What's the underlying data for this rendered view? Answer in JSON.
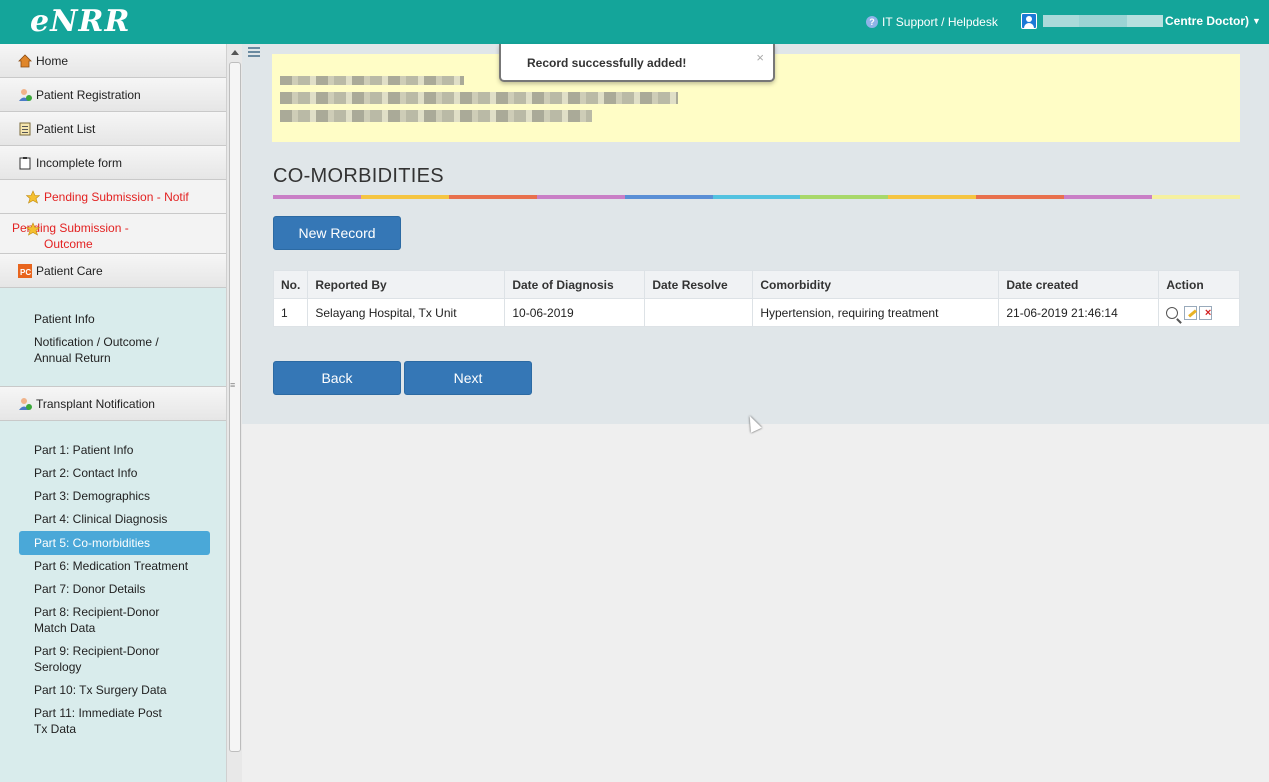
{
  "app": {
    "logo": "eNRR"
  },
  "header": {
    "support_label": "IT Support / Helpdesk",
    "user_label": "Centre Doctor)"
  },
  "sidebar": {
    "items": [
      {
        "label": "Home",
        "icon": "home-icon"
      },
      {
        "label": "Patient Registration",
        "icon": "user-add-icon"
      },
      {
        "label": "Patient List",
        "icon": "list-icon"
      },
      {
        "label": "Incomplete form",
        "icon": "clipboard-icon"
      },
      {
        "label": "Pending Submission - Notif",
        "icon": "star-icon"
      },
      {
        "label": "Pending Submission - Outcome",
        "icon": "star-icon"
      },
      {
        "label": "Patient Care",
        "icon": "pc-icon"
      }
    ],
    "patient_care_sub": [
      "Patient Info",
      "Notification / Outcome / Annual Return"
    ],
    "transplant_label": "Transplant Notification",
    "transplant_sub": [
      "Part 1: Patient Info",
      "Part 2: Contact Info",
      "Part 3: Demographics",
      "Part 4: Clinical Diagnosis",
      "Part 5: Co-morbidities",
      "Part 6: Medication Treatment",
      "Part 7: Donor Details",
      "Part 8: Recipient-Donor Match Data",
      "Part 9: Recipient-Donor Serology",
      "Part 10: Tx Surgery Data",
      "Part 11: Immediate Post Tx Data"
    ],
    "active_index": 4
  },
  "toast": {
    "message": "Record successfully added!",
    "close": "×"
  },
  "main": {
    "title": "CO-MORBIDITIES",
    "new_record_label": "New Record",
    "back_label": "Back",
    "next_label": "Next",
    "table": {
      "headers": [
        "No.",
        "Reported By",
        "Date of Diagnosis",
        "Date Resolve",
        "Comorbidity",
        "Date created",
        "Action"
      ],
      "rows": [
        [
          "1",
          "Selayang Hospital, Tx Unit",
          "10-06-2019",
          "",
          "Hypertension, requiring treatment",
          "21-06-2019 21:46:14"
        ]
      ]
    }
  },
  "colors": {
    "topbar": "#14a59a",
    "button": "#3577b6",
    "active_nav": "#4aa8d8",
    "pending": "#e32222",
    "banner": "#fffdc6",
    "rainbow": [
      "#c97fc6",
      "#f5c542",
      "#e8704d",
      "#c97fc6",
      "#5a8fd6",
      "#52c2e0",
      "#a8d86a",
      "#f5c542",
      "#e8704d",
      "#c97fc6",
      "#f5f0a0"
    ]
  }
}
